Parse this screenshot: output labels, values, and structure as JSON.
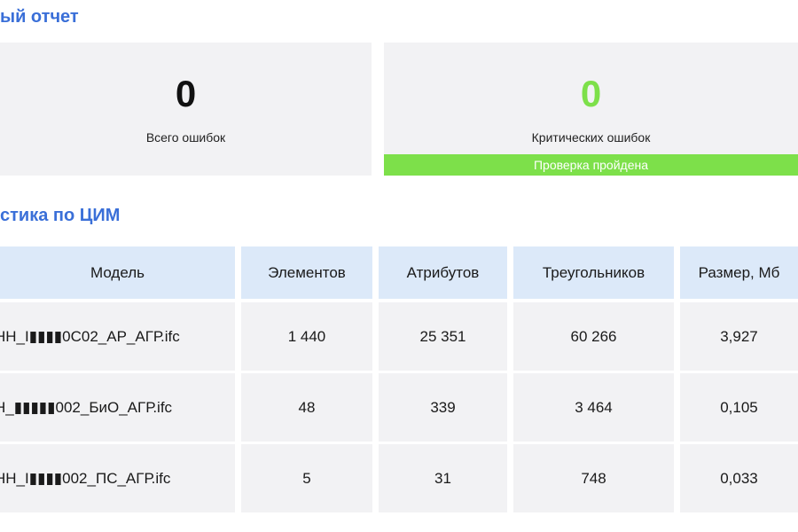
{
  "report_title": "ый отчет",
  "stats_title": "стика по ЦИМ",
  "cards": {
    "total": {
      "value": "0",
      "label": "Всего ошибок"
    },
    "critical": {
      "value": "0",
      "label": "Критических ошибок",
      "status": "Проверка пройдена"
    }
  },
  "colors": {
    "accent": "#3a6fd8",
    "success": "#7de04a",
    "card_bg": "#f2f2f4",
    "header_bg": "#dce9f9"
  },
  "table": {
    "columns": [
      "Модель",
      "Элементов",
      "Атрибутов",
      "Треугольников",
      "Размер, Мб"
    ],
    "rows": [
      [
        "НН_I▮▮▮▮0С02_АР_АГР.ifc",
        "1 440",
        "25 351",
        "60 266",
        "3,927"
      ],
      [
        "Н_▮▮▮▮▮002_БиО_АГР.ifc",
        "48",
        "339",
        "3 464",
        "0,105"
      ],
      [
        "НН_I▮▮▮▮002_ПС_АГР.ifc",
        "5",
        "31",
        "748",
        "0,033"
      ]
    ]
  }
}
